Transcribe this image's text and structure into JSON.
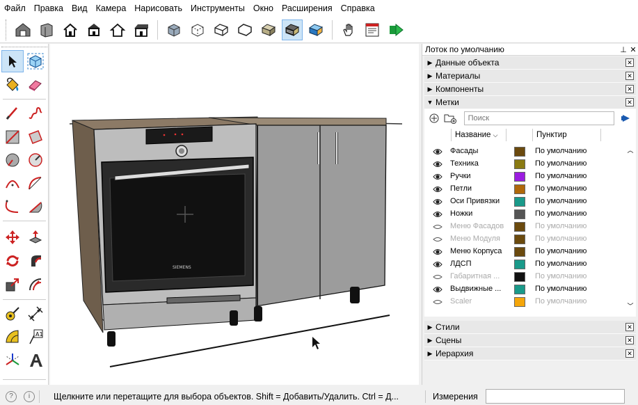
{
  "menu": [
    "Файл",
    "Правка",
    "Вид",
    "Камера",
    "Нарисовать",
    "Инструменты",
    "Окно",
    "Расширения",
    "Справка"
  ],
  "toolbar_icons": [
    "warehouse-icon",
    "component-icon",
    "home-icon",
    "house-front-icon",
    "house-outline-icon",
    "house-roof-icon",
    "xray-style-icon",
    "back-edges-style-icon",
    "wireframe-style-icon",
    "hidden-line-style-icon",
    "shaded-style-icon",
    "shaded-textures-style-icon",
    "monochrome-style-icon",
    "hand-tool-icon",
    "layout-icon",
    "extension-run-icon"
  ],
  "tray": {
    "title": "Лоток по умолчанию",
    "panels_top": [
      "Данные объекта",
      "Материалы",
      "Компоненты"
    ],
    "tags_panel_title": "Метки",
    "search_placeholder": "Поиск",
    "col_name": "Название",
    "col_dash": "Пунктир",
    "tags": [
      {
        "name": "Фасады",
        "color": "#6b4a0e",
        "dash": "По умолчанию",
        "visible": true
      },
      {
        "name": "Техника",
        "color": "#8a7a12",
        "dash": "По умолчанию",
        "visible": true
      },
      {
        "name": "Ручки",
        "color": "#9b1de0",
        "dash": "По умолчанию",
        "visible": true
      },
      {
        "name": "Петли",
        "color": "#b0680a",
        "dash": "По умолчанию",
        "visible": true
      },
      {
        "name": "Оси Привязки",
        "color": "#1a9a8a",
        "dash": "По умолчанию",
        "visible": true
      },
      {
        "name": "Ножки",
        "color": "#555555",
        "dash": "По умолчанию",
        "visible": true
      },
      {
        "name": "Меню Фасадов",
        "color": "#6b4a0e",
        "dash": "По умолчанию",
        "visible": false
      },
      {
        "name": "Меню Модуля",
        "color": "#6b4a0e",
        "dash": "По умолчанию",
        "visible": false
      },
      {
        "name": "Меню Корпуса",
        "color": "#6b4a0e",
        "dash": "По умолчанию",
        "visible": true
      },
      {
        "name": "ЛДСП",
        "color": "#1a9a8a",
        "dash": "По умолчанию",
        "visible": true
      },
      {
        "name": "Габаритная ...",
        "color": "#111111",
        "dash": "По умолчанию",
        "visible": false
      },
      {
        "name": "Выдвижные ...",
        "color": "#1a9a8a",
        "dash": "По умолчанию",
        "visible": true
      },
      {
        "name": "Scaler",
        "color": "#f5a60a",
        "dash": "По умолчанию",
        "visible": false
      }
    ],
    "panels_bottom": [
      "Стили",
      "Сцены",
      "Иерархия"
    ]
  },
  "model": {
    "oven_brand": "SIEMENS"
  },
  "status": {
    "hint": "Щелкните или перетащите для выбора объектов. Shift = Добавить/Удалить. Ctrl = Д...",
    "measurements_label": "Измерения",
    "measurements_value": ""
  }
}
